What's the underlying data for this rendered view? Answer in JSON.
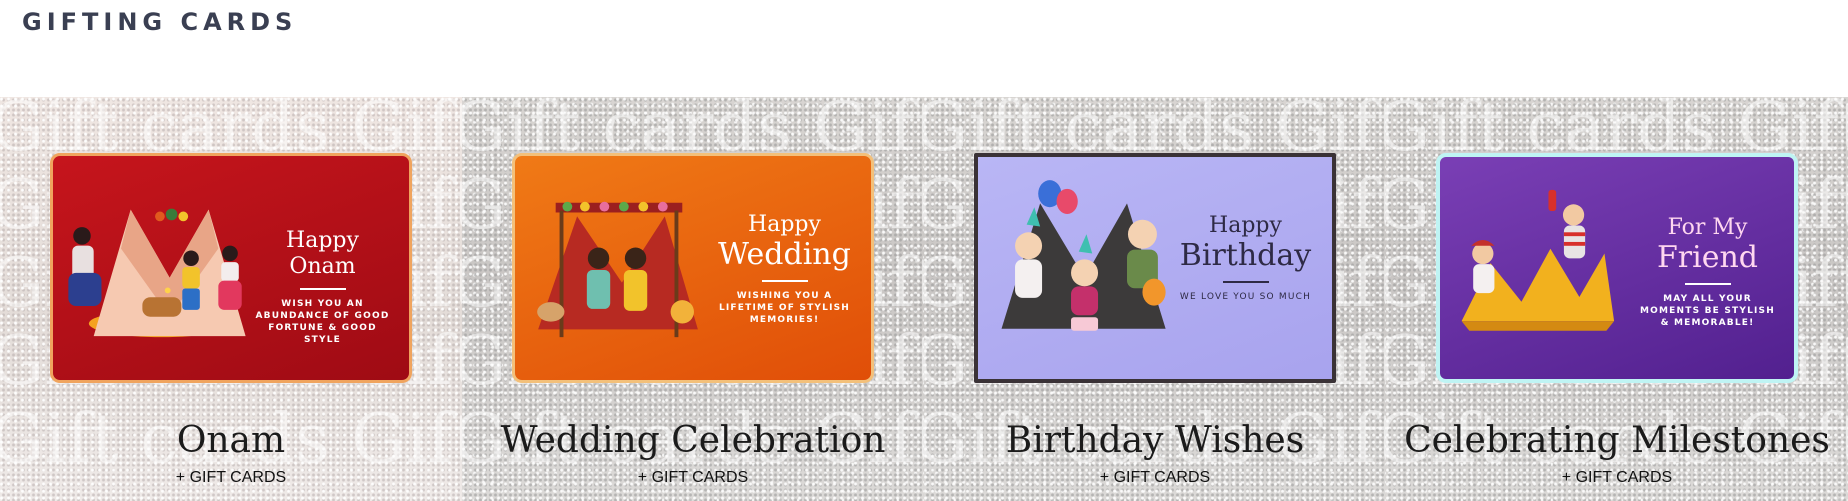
{
  "header": {
    "title": "GIFTING CARDS"
  },
  "watermark_text": "Gift cards Gift cards Gift cards",
  "cards": [
    {
      "name": "Onam",
      "link_label": "+ GIFT CARDS",
      "greeting": {
        "line1": "Happy Onam",
        "line2": "",
        "sub": "WISH YOU AN ABUNDANCE OF GOOD FORTUNE & GOOD STYLE"
      },
      "colors": {
        "card": "#b8101a",
        "text": "#ffffff"
      }
    },
    {
      "name": "Wedding Celebration",
      "link_label": "+ GIFT CARDS",
      "greeting": {
        "line1": "Happy",
        "line2": "Wedding",
        "sub": "WISHING YOU A LIFETIME OF STYLISH MEMORIES!"
      },
      "colors": {
        "card": "#e9640e",
        "text": "#ffffff"
      }
    },
    {
      "name": "Birthday Wishes",
      "link_label": "+ GIFT CARDS",
      "greeting": {
        "line1": "Happy",
        "line2": "Birthday",
        "sub": "WE LOVE YOU SO MUCH"
      },
      "colors": {
        "card": "#b0acf2",
        "text": "#2e2a45"
      }
    },
    {
      "name": "Celebrating Milestones",
      "link_label": "+ GIFT CARDS",
      "greeting": {
        "line1": "For My",
        "line2": "Friend",
        "sub": "MAY ALL YOUR MOMENTS BE STYLISH & MEMORABLE!"
      },
      "colors": {
        "card": "#6a30a6",
        "text": "#ffd7f0"
      }
    }
  ]
}
